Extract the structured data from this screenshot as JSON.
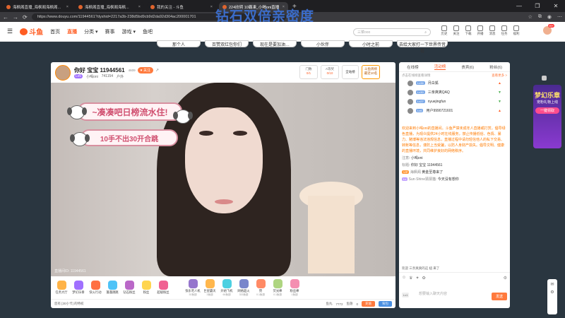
{
  "browser": {
    "tabs": [
      {
        "title": "海枫阁直播_海枫阁海枫阁..."
      },
      {
        "title": "海枫阁直播_海枫阁海枫..."
      },
      {
        "title": "我的关注 - 斗鱼"
      },
      {
        "title": "224欣玥 10霸凍_小喝oni直播"
      }
    ],
    "new_tab": "+",
    "window_controls": [
      "—",
      "❐",
      "✕"
    ],
    "url": "https://www.douyu.com/11944561?dyshid=2217a3b-238d5bd9cb9d2da92d304ac200001701"
  },
  "promo_text": "钻石双倍亲密度",
  "header": {
    "logo": "斗鱼",
    "nav": [
      "首页",
      "直播",
      "分类",
      "赛事",
      "游戏",
      "鱼吧"
    ],
    "search_placeholder": "三菜ooo",
    "icons": [
      "历史",
      "关注",
      "下载",
      "开播",
      "消息",
      "任务",
      "福利"
    ],
    "avatar_badge": "99+"
  },
  "banner_tabs": [
    "那个人",
    "百赞双红包你们",
    "现在是要加油…",
    "小伙伴",
    "小时之前",
    "去给大家打一下世界传音看"
  ],
  "anchor": {
    "title": "你好 宝宝 11944561",
    "hint": "4609",
    "follow": "关注",
    "level": "Lv5",
    "name": "小喝oni",
    "followers": "741154",
    "category": "户外",
    "stats": [
      {
        "label": "门数",
        "value": "0/1"
      },
      {
        "label": "A等奖",
        "value": "0/10"
      }
    ],
    "btn_all_gifts": "全站榜",
    "btn_weekly": "斗鱼周榜",
    "btn_weekly_sub": "最近10名"
  },
  "video": {
    "sticker1": "~凑凑吧日榜流水住!",
    "sticker2": "10手不出30开合跳",
    "watermark": "直播间ID: 11944561"
  },
  "gifts": [
    {
      "name": "任务大厅",
      "sub": "",
      "color": "#ffb347"
    },
    {
      "name": "梦幻乐章",
      "sub": "",
      "color": "#a070ff"
    },
    {
      "name": "快火行动",
      "sub": "",
      "color": "#ff7043"
    },
    {
      "name": "蓬蓬跳跳",
      "sub": "",
      "color": "#4fc3f7"
    },
    {
      "name": "钻石粉丝",
      "sub": "",
      "color": "#ba68c8"
    },
    {
      "name": "粉丝",
      "sub": "",
      "color": "#ffd54f"
    },
    {
      "name": "超级粉丝",
      "sub": "",
      "color": "#f06292"
    },
    {
      "name": "快乐宅人机",
      "sub": "30鱼翅",
      "color": "#9575cd"
    },
    {
      "name": "巨星霸天",
      "sub": "3鱼翅",
      "color": "#ffb74d"
    },
    {
      "name": "开始飞机",
      "sub": "66鱼翅",
      "color": "#4dd0e1"
    },
    {
      "name": "网络超火",
      "sub": "333鱼翅",
      "color": "#7986cb"
    },
    {
      "name": "赞",
      "sub": "0.1鱼翅",
      "color": "#ff8a65"
    },
    {
      "name": "荧光棒",
      "sub": "0.1鱼翅",
      "color": "#aed581"
    },
    {
      "name": "粉丝棒",
      "sub": "1鱼翅",
      "color": "#f48fb1"
    }
  ],
  "bottom": {
    "left": "您有 [30小卡] 的特权",
    "coins_label": "鱼丸",
    "coins_value": "7772",
    "fins_label": "鱼翅",
    "fins_value": "0",
    "recharge": "充值",
    "bag": "背包"
  },
  "sidebar": {
    "tabs": [
      "在线榜",
      "活动榜",
      "贵宾(6)",
      "粉丝(6)"
    ],
    "active_tab": 1,
    "hint": "点击在线榜查看详情",
    "more": "查看更多 >",
    "ranks": [
      {
        "no": "1",
        "lv": "Lv36",
        "name": "月白狐",
        "trend": "▲",
        "color": "#ff5d23"
      },
      {
        "no": "2",
        "lv": "Lv30",
        "name": "三亲爽爽QAQ",
        "trend": "▼",
        "color": "#4caf50"
      },
      {
        "no": "3",
        "lv": "Lv27",
        "name": "nyuejingfun",
        "trend": "▼",
        "color": "#4caf50"
      },
      {
        "no": "4",
        "lv": "Lv6",
        "name": "用户9990721601",
        "trend": "▲",
        "color": "#ff5d23"
      }
    ],
    "system_msg": "欢迎来到小喝oni的直播间。斗鱼严禁未成年人直播或打赏。倡导绿色直播，为观众提供24小时在线服务，禁止传播低俗、色情、暴力、赌博等违法违规信息，直播过程中请勿轻信他人的私下交易、转账等信息，谨防上当受骗，以防人身财产损失。倡导文明、健康的直播环境，共同维护良好的网络秩序。",
    "messages": [
      {
        "tag": "注意",
        "text": "小喝oni"
      },
      {
        "tag": "标题",
        "text": "你好 宝宝 11944561"
      },
      {
        "tag": "VIP",
        "name": "海枫阁",
        "text": "黄金至尊来了"
      },
      {
        "tag": "Lv",
        "name": "Sun·Shine猜猜猫:",
        "text": "今天没有想你"
      }
    ],
    "welcome": "欢迎 三亲爽爽的这 妞 来了",
    "input_placeholder": "想要输入聊天内容",
    "send": "发送",
    "badge": "Lv1"
  },
  "right_ad": {
    "title": "梦幻乐章",
    "sub": "宠粉礼物上线",
    "cta": "一键领取"
  }
}
